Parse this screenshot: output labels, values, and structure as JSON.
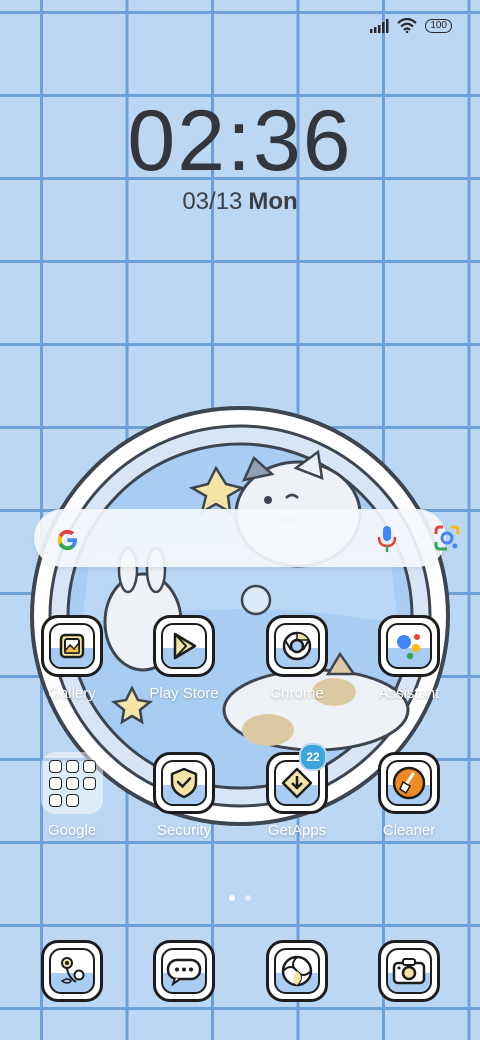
{
  "status_bar": {
    "battery": "100",
    "signal_icon": "signal-bars-icon",
    "wifi_icon": "wifi-icon"
  },
  "lock": {
    "time": "02:36",
    "date": "03/13",
    "weekday": "Mon"
  },
  "search_bar": {
    "logo_icon": "google-g-icon",
    "voice_icon": "mic-icon",
    "lens_icon": "google-lens-icon"
  },
  "apps": [
    {
      "label": "Gallery",
      "icon": "gallery-icon"
    },
    {
      "label": "Play Store",
      "icon": "play-store-icon"
    },
    {
      "label": "Chrome",
      "icon": "chrome-icon"
    },
    {
      "label": "Assistant",
      "icon": "assistant-icon"
    },
    {
      "label": "Google",
      "icon": "folder-icon"
    },
    {
      "label": "Security",
      "icon": "shield-icon"
    },
    {
      "label": "GetApps",
      "icon": "download-icon",
      "badge": "22"
    },
    {
      "label": "Cleaner",
      "icon": "broom-icon"
    }
  ],
  "page_indicator": {
    "pages": 2,
    "current": 1
  },
  "dock": [
    {
      "icon": "flower-icon"
    },
    {
      "icon": "messages-icon"
    },
    {
      "icon": "aperture-icon"
    },
    {
      "icon": "camera-icon"
    }
  ],
  "colors": {
    "background": "#bcd7f3",
    "grid_lines": "#6f9fd8",
    "badge": "#3aa6dc",
    "cleaner_orange": "#f08a24"
  }
}
